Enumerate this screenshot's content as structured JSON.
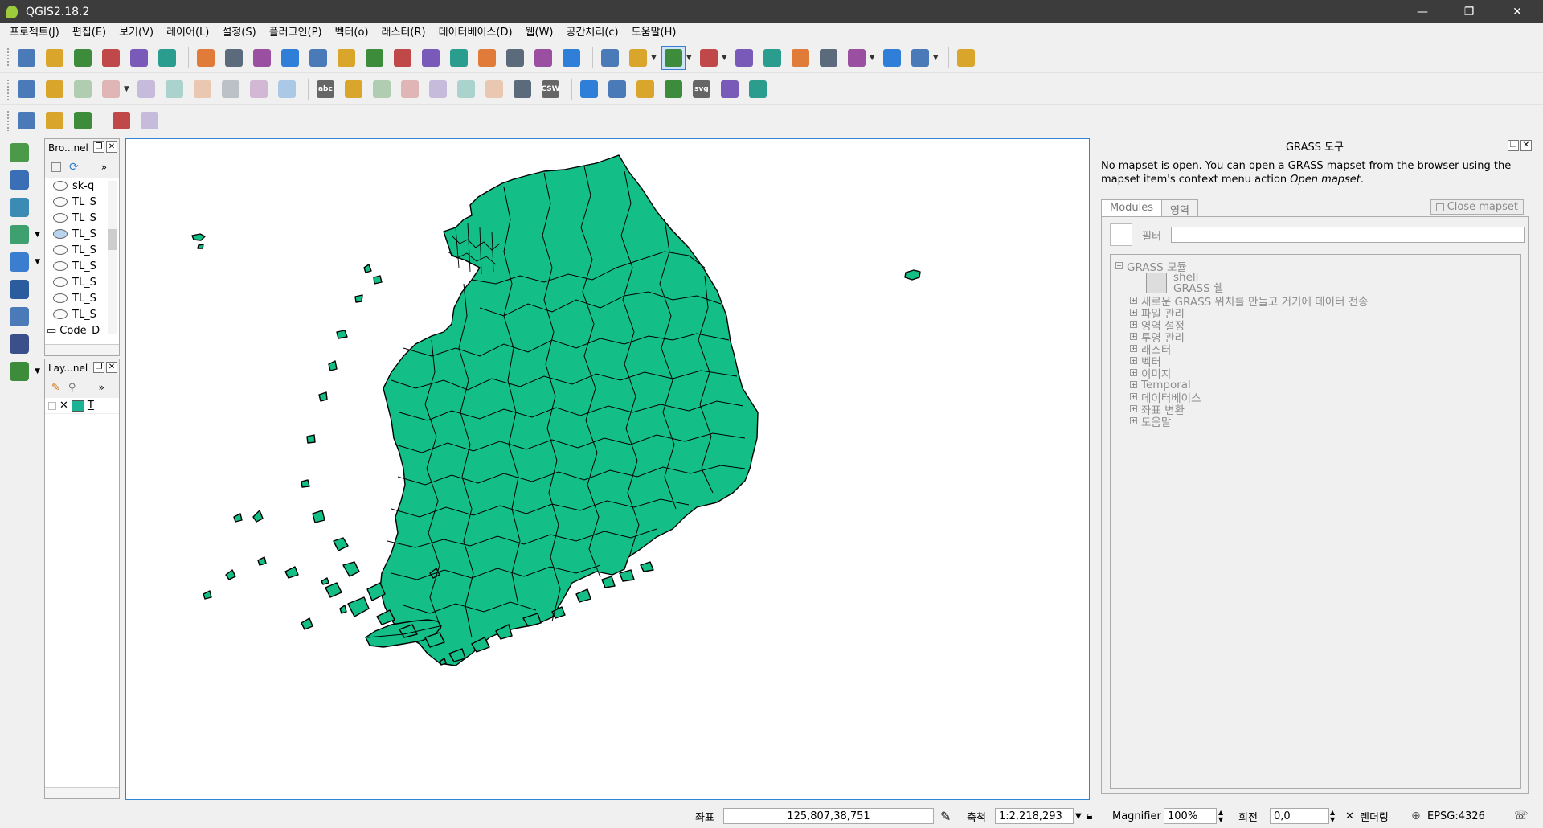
{
  "window": {
    "title": "QGIS2.18.2",
    "minimize": "—",
    "restore": "❐",
    "close": "✕"
  },
  "menu": [
    "프로젝트(J)",
    "편집(E)",
    "보기(V)",
    "레이어(L)",
    "설정(S)",
    "플러그인(P)",
    "벡터(o)",
    "래스터(R)",
    "데이터베이스(D)",
    "웹(W)",
    "공간처리(c)",
    "도움말(H)"
  ],
  "toolbar_icons": {
    "row1": [
      "new-project-icon",
      "open-project-icon",
      "save-project-icon",
      "save-as-icon",
      "print-composer-icon",
      "composer-manager-icon",
      "touch-zoom-icon",
      "pan-icon",
      "pan-to-selection-icon",
      "zoom-in-icon",
      "zoom-out-icon",
      "zoom-actual-icon",
      "zoom-full-icon",
      "zoom-layer-icon",
      "zoom-selection-icon",
      "zoom-last-icon",
      "zoom-next-icon",
      "new-bookmark-icon",
      "show-bookmarks-icon",
      "refresh-icon",
      "identify-icon",
      "action-icon",
      "select-feature-icon",
      "select-by-expression-icon",
      "deselect-icon",
      "attribute-table-icon",
      "field-calculator-icon",
      "statistics-icon",
      "measure-icon",
      "map-tips-icon",
      "text-annotation-icon",
      "help-icon"
    ],
    "row2": [
      "current-edits-icon",
      "toggle-editing-icon",
      "save-edits-icon",
      "add-feature-icon",
      "move-feature-icon",
      "node-tool-icon",
      "delete-selected-icon",
      "cut-features-icon",
      "copy-features-icon",
      "paste-features-icon",
      "label-icon",
      "diagram-icon",
      "pin-labels-icon",
      "show-hide-labels-icon",
      "move-label-icon",
      "rotate-label-icon",
      "change-label-icon",
      "layer-style-icon",
      "csw-icon",
      "python-console-icon",
      "grass-tools-icon",
      "geoprocessing-icon",
      "plugin-icon",
      "svg-icon",
      "metasearch-icon",
      "info-search-icon"
    ],
    "row3": [
      "georeferencer-icon",
      "table-icon",
      "gps-icon",
      "d3-icon",
      "gear-icon"
    ]
  },
  "labels": {
    "csw": "CSW",
    "svg": "svg",
    "abc": "abc",
    "t_label": "T"
  },
  "left_tools": [
    "add-vector-layer-icon",
    "add-raster-layer-icon",
    "add-delimited-text-icon",
    "add-wms-layer-icon",
    "add-wfs-layer-icon",
    "add-wcs-layer-icon",
    "add-spatialite-icon",
    "add-postgis-icon",
    "new-shapefile-icon"
  ],
  "browser": {
    "title": "Bro...nel",
    "items": [
      "sk-q",
      "TL_S",
      "TL_S",
      "TL_S",
      "TL_S",
      "TL_S",
      "TL_S",
      "TL_S",
      "TL_S"
    ],
    "footer": "Code_D"
  },
  "layers": {
    "title": "Lay...nel",
    "item_label": "T",
    "layer_color": "#1ab394"
  },
  "grass": {
    "title": "GRASS 도구",
    "message_line1": "No mapset is open. You can open a GRASS mapset from the browser using the",
    "message_line2_pre": "mapset item's context menu action ",
    "message_line2_italic": "Open mapset",
    "message_line2_post": ".",
    "tabs": [
      "Modules",
      "영역"
    ],
    "close_mapset": "Close mapset",
    "filter_label": "필터",
    "modules": {
      "root": "GRASS 모듈",
      "shell": "shell",
      "shell_desc": "GRASS 쉘",
      "groups": [
        "새로운 GRASS 위치를 만들고 거기에 데이터 전송",
        "파일 관리",
        "영역 설정",
        "투영 관리",
        "래스터",
        "벡터",
        "이미지",
        "Temporal",
        "데이터베이스",
        "좌표 변환",
        "도움말"
      ]
    }
  },
  "status": {
    "coord_label": "좌표",
    "coord_value": "125,807,38,751",
    "scale_label": "축척",
    "scale_value": "1:2,218,293",
    "magnifier_label": "Magnifier",
    "magnifier_value": "100%",
    "rotation_label": "회전",
    "rotation_value": "0,0",
    "render_label": "렌더링",
    "crs": "EPSG:4326"
  },
  "colors": {
    "land_fill": "#13bf86",
    "outline": "#000000",
    "canvas_border": "#2f86d6"
  }
}
